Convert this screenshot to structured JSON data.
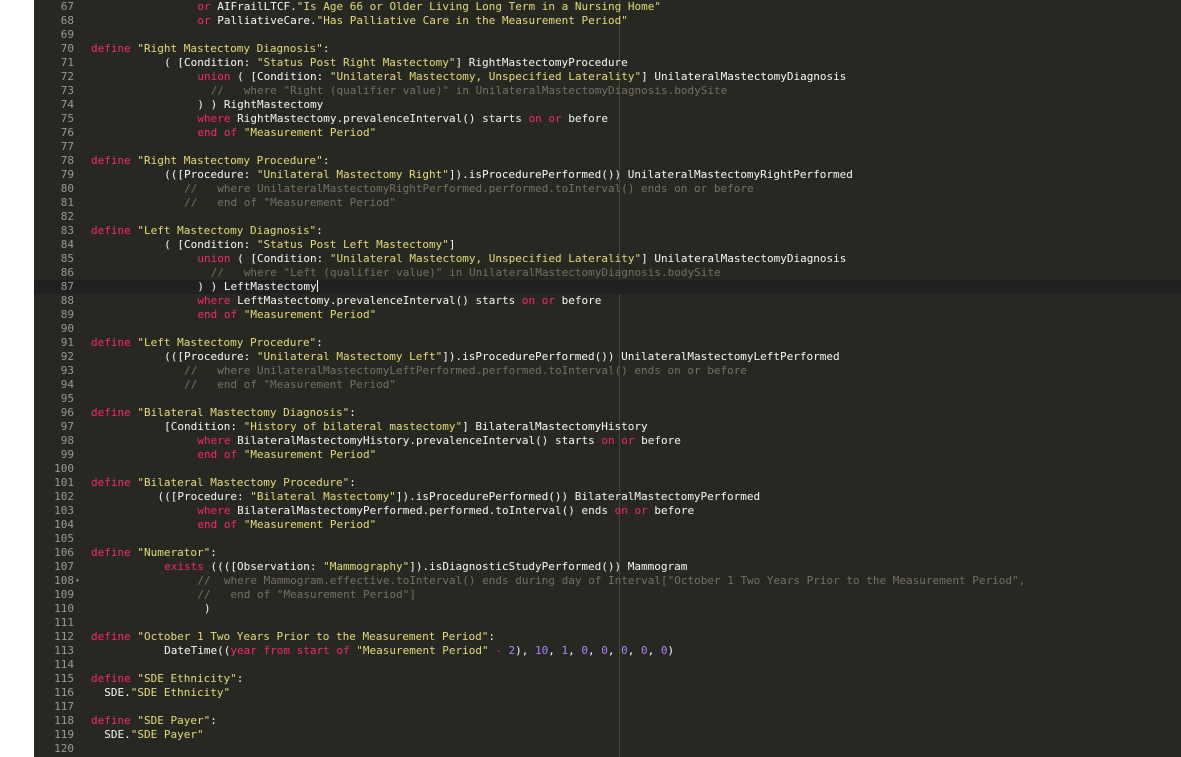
{
  "editor": {
    "active_line": 87,
    "cursor_line": 87,
    "lines": [
      {
        "n": "67",
        "i": 16,
        "t": [
          [
            "kw",
            "or"
          ],
          [
            "pl",
            " AIFrailLTCF."
          ],
          [
            "str",
            "\"Is Age 66 or Older Living Long Term in a Nursing Home\""
          ]
        ]
      },
      {
        "n": "68",
        "i": 16,
        "t": [
          [
            "kw",
            "or"
          ],
          [
            "pl",
            " PalliativeCare."
          ],
          [
            "str",
            "\"Has Palliative Care in the Measurement Period\""
          ]
        ]
      },
      {
        "n": "69",
        "i": 0,
        "t": []
      },
      {
        "n": "70",
        "i": 0,
        "t": [
          [
            "kw",
            "define"
          ],
          [
            "pl",
            " "
          ],
          [
            "str",
            "\"Right Mastectomy Diagnosis\""
          ],
          [
            "pl",
            ":"
          ]
        ]
      },
      {
        "n": "71",
        "i": 11,
        "t": [
          [
            "pl",
            "( [Condition: "
          ],
          [
            "str",
            "\"Status Post Right Mastectomy\""
          ],
          [
            "pl",
            "] RightMastectomyProcedure"
          ]
        ]
      },
      {
        "n": "72",
        "i": 16,
        "t": [
          [
            "kw",
            "union"
          ],
          [
            "pl",
            " ( [Condition: "
          ],
          [
            "str",
            "\"Unilateral Mastectomy, Unspecified Laterality\""
          ],
          [
            "pl",
            "] UnilateralMastectomyDiagnosis"
          ]
        ]
      },
      {
        "n": "73",
        "i": 18,
        "t": [
          [
            "cm",
            "//   where \"Right (qualifier value)\" in UnilateralMastectomyDiagnosis.bodySite"
          ]
        ]
      },
      {
        "n": "74",
        "i": 16,
        "t": [
          [
            "pl",
            ") ) RightMastectomy"
          ]
        ]
      },
      {
        "n": "75",
        "i": 16,
        "t": [
          [
            "kw",
            "where"
          ],
          [
            "pl",
            " RightMastectomy.prevalenceInterval() starts "
          ],
          [
            "kw",
            "on"
          ],
          [
            "pl",
            " "
          ],
          [
            "kw",
            "or"
          ],
          [
            "pl",
            " before"
          ]
        ]
      },
      {
        "n": "76",
        "i": 16,
        "t": [
          [
            "kw",
            "end of"
          ],
          [
            "pl",
            " "
          ],
          [
            "str",
            "\"Measurement Period\""
          ]
        ]
      },
      {
        "n": "77",
        "i": 0,
        "t": []
      },
      {
        "n": "78",
        "i": 0,
        "t": [
          [
            "kw",
            "define"
          ],
          [
            "pl",
            " "
          ],
          [
            "str",
            "\"Right Mastectomy Procedure\""
          ],
          [
            "pl",
            ":"
          ]
        ]
      },
      {
        "n": "79",
        "i": 11,
        "t": [
          [
            "pl",
            "(([Procedure: "
          ],
          [
            "str",
            "\"Unilateral Mastectomy Right\""
          ],
          [
            "pl",
            "]).isProcedurePerformed()) UnilateralMastectomyRightPerformed"
          ]
        ]
      },
      {
        "n": "80",
        "i": 14,
        "t": [
          [
            "cm",
            "//   where UnilateralMastectomyRightPerformed.performed.toInterval() ends on or before"
          ]
        ]
      },
      {
        "n": "81",
        "i": 14,
        "t": [
          [
            "cm",
            "//   end of \"Measurement Period\""
          ]
        ]
      },
      {
        "n": "82",
        "i": 0,
        "t": []
      },
      {
        "n": "83",
        "i": 0,
        "t": [
          [
            "kw",
            "define"
          ],
          [
            "pl",
            " "
          ],
          [
            "str",
            "\"Left Mastectomy Diagnosis\""
          ],
          [
            "pl",
            ":"
          ]
        ]
      },
      {
        "n": "84",
        "i": 11,
        "t": [
          [
            "pl",
            "( [Condition: "
          ],
          [
            "str",
            "\"Status Post Left Mastectomy\""
          ],
          [
            "pl",
            "]"
          ]
        ]
      },
      {
        "n": "85",
        "i": 16,
        "t": [
          [
            "kw",
            "union"
          ],
          [
            "pl",
            " ( [Condition: "
          ],
          [
            "str",
            "\"Unilateral Mastectomy, Unspecified Laterality\""
          ],
          [
            "pl",
            "] UnilateralMastectomyDiagnosis"
          ]
        ]
      },
      {
        "n": "86",
        "i": 18,
        "t": [
          [
            "cm",
            "//   where \"Left (qualifier value)\" in UnilateralMastectomyDiagnosis.bodySite"
          ]
        ]
      },
      {
        "n": "87",
        "i": 16,
        "t": [
          [
            "pl",
            ") ) LeftMastectomy"
          ]
        ]
      },
      {
        "n": "88",
        "i": 16,
        "t": [
          [
            "kw",
            "where"
          ],
          [
            "pl",
            " LeftMastectomy.prevalenceInterval() starts "
          ],
          [
            "kw",
            "on"
          ],
          [
            "pl",
            " "
          ],
          [
            "kw",
            "or"
          ],
          [
            "pl",
            " before"
          ]
        ]
      },
      {
        "n": "89",
        "i": 16,
        "t": [
          [
            "kw",
            "end of"
          ],
          [
            "pl",
            " "
          ],
          [
            "str",
            "\"Measurement Period\""
          ]
        ]
      },
      {
        "n": "90",
        "i": 0,
        "t": []
      },
      {
        "n": "91",
        "i": 0,
        "t": [
          [
            "kw",
            "define"
          ],
          [
            "pl",
            " "
          ],
          [
            "str",
            "\"Left Mastectomy Procedure\""
          ],
          [
            "pl",
            ":"
          ]
        ]
      },
      {
        "n": "92",
        "i": 11,
        "t": [
          [
            "pl",
            "(([Procedure: "
          ],
          [
            "str",
            "\"Unilateral Mastectomy Left\""
          ],
          [
            "pl",
            "]).isProcedurePerformed()) UnilateralMastectomyLeftPerformed"
          ]
        ]
      },
      {
        "n": "93",
        "i": 14,
        "t": [
          [
            "cm",
            "//   where UnilateralMastectomyLeftPerformed.performed.toInterval() ends on or before"
          ]
        ]
      },
      {
        "n": "94",
        "i": 14,
        "t": [
          [
            "cm",
            "//   end of \"Measurement Period\""
          ]
        ]
      },
      {
        "n": "95",
        "i": 0,
        "t": []
      },
      {
        "n": "96",
        "i": 0,
        "t": [
          [
            "kw",
            "define"
          ],
          [
            "pl",
            " "
          ],
          [
            "str",
            "\"Bilateral Mastectomy Diagnosis\""
          ],
          [
            "pl",
            ":"
          ]
        ]
      },
      {
        "n": "97",
        "i": 11,
        "t": [
          [
            "pl",
            "[Condition: "
          ],
          [
            "str",
            "\"History of bilateral mastectomy\""
          ],
          [
            "pl",
            "] BilateralMastectomyHistory"
          ]
        ]
      },
      {
        "n": "98",
        "i": 16,
        "t": [
          [
            "kw",
            "where"
          ],
          [
            "pl",
            " BilateralMastectomyHistory.prevalenceInterval() starts "
          ],
          [
            "kw",
            "on"
          ],
          [
            "pl",
            " "
          ],
          [
            "kw",
            "or"
          ],
          [
            "pl",
            " before"
          ]
        ]
      },
      {
        "n": "99",
        "i": 16,
        "t": [
          [
            "kw",
            "end of"
          ],
          [
            "pl",
            " "
          ],
          [
            "str",
            "\"Measurement Period\""
          ]
        ]
      },
      {
        "n": "100",
        "i": 0,
        "t": []
      },
      {
        "n": "101",
        "i": 0,
        "t": [
          [
            "kw",
            "define"
          ],
          [
            "pl",
            " "
          ],
          [
            "str",
            "\"Bilateral Mastectomy Procedure\""
          ],
          [
            "pl",
            ":"
          ]
        ]
      },
      {
        "n": "102",
        "i": 10,
        "t": [
          [
            "pl",
            "(([Procedure: "
          ],
          [
            "str",
            "\"Bilateral Mastectomy\""
          ],
          [
            "pl",
            "]).isProcedurePerformed()) BilateralMastectomyPerformed"
          ]
        ]
      },
      {
        "n": "103",
        "i": 16,
        "t": [
          [
            "kw",
            "where"
          ],
          [
            "pl",
            " BilateralMastectomyPerformed.performed.toInterval() ends "
          ],
          [
            "kw",
            "on"
          ],
          [
            "pl",
            " "
          ],
          [
            "kw",
            "or"
          ],
          [
            "pl",
            " before"
          ]
        ]
      },
      {
        "n": "104",
        "i": 16,
        "t": [
          [
            "kw",
            "end of"
          ],
          [
            "pl",
            " "
          ],
          [
            "str",
            "\"Measurement Period\""
          ]
        ]
      },
      {
        "n": "105",
        "i": 0,
        "t": []
      },
      {
        "n": "106",
        "i": 0,
        "t": [
          [
            "kw",
            "define"
          ],
          [
            "pl",
            " "
          ],
          [
            "str",
            "\"Numerator\""
          ],
          [
            "pl",
            ":"
          ]
        ]
      },
      {
        "n": "107",
        "i": 11,
        "t": [
          [
            "kw",
            "exists"
          ],
          [
            "pl",
            " (((["
          ],
          [
            "pl",
            "Observation: "
          ],
          [
            "str",
            "\"Mammography\""
          ],
          [
            "pl",
            "]).isDiagnosticStudyPerformed()) Mammogram"
          ]
        ]
      },
      {
        "n": "108",
        "i": 16,
        "fold": true,
        "t": [
          [
            "cm",
            "//  where Mammogram.effective.toInterval() ends during day of Interval[\"October 1 Two Years Prior to the Measurement Period\","
          ]
        ]
      },
      {
        "n": "109",
        "i": 16,
        "t": [
          [
            "cm",
            "//   end of \"Measurement Period\"]"
          ]
        ]
      },
      {
        "n": "110",
        "i": 17,
        "t": [
          [
            "pl",
            ")"
          ]
        ]
      },
      {
        "n": "111",
        "i": 0,
        "t": []
      },
      {
        "n": "112",
        "i": 0,
        "t": [
          [
            "kw",
            "define"
          ],
          [
            "pl",
            " "
          ],
          [
            "str",
            "\"October 1 Two Years Prior to the Measurement Period\""
          ],
          [
            "pl",
            ":"
          ]
        ]
      },
      {
        "n": "113",
        "i": 11,
        "t": [
          [
            "pl",
            "DateTime(("
          ],
          [
            "kw",
            "year from start of"
          ],
          [
            "pl",
            " "
          ],
          [
            "str",
            "\"Measurement Period\""
          ],
          [
            "pl",
            " "
          ],
          [
            "kw",
            "-"
          ],
          [
            "pl",
            " "
          ],
          [
            "num",
            "2"
          ],
          [
            "pl",
            "), "
          ],
          [
            "num",
            "10"
          ],
          [
            "pl",
            ", "
          ],
          [
            "num",
            "1"
          ],
          [
            "pl",
            ", "
          ],
          [
            "num",
            "0"
          ],
          [
            "pl",
            ", "
          ],
          [
            "num",
            "0"
          ],
          [
            "pl",
            ", "
          ],
          [
            "num",
            "0"
          ],
          [
            "pl",
            ", "
          ],
          [
            "num",
            "0"
          ],
          [
            "pl",
            ", "
          ],
          [
            "num",
            "0"
          ],
          [
            "pl",
            ")"
          ]
        ]
      },
      {
        "n": "114",
        "i": 0,
        "t": []
      },
      {
        "n": "115",
        "i": 0,
        "t": [
          [
            "kw",
            "define"
          ],
          [
            "pl",
            " "
          ],
          [
            "str",
            "\"SDE Ethnicity\""
          ],
          [
            "pl",
            ":"
          ]
        ]
      },
      {
        "n": "116",
        "i": 2,
        "t": [
          [
            "pl",
            "SDE."
          ],
          [
            "str",
            "\"SDE Ethnicity\""
          ]
        ]
      },
      {
        "n": "117",
        "i": 0,
        "t": []
      },
      {
        "n": "118",
        "i": 0,
        "t": [
          [
            "kw",
            "define"
          ],
          [
            "pl",
            " "
          ],
          [
            "str",
            "\"SDE Payer\""
          ],
          [
            "pl",
            ":"
          ]
        ]
      },
      {
        "n": "119",
        "i": 2,
        "t": [
          [
            "pl",
            "SDE."
          ],
          [
            "str",
            "\"SDE Payer\""
          ]
        ]
      },
      {
        "n": "120",
        "i": 0,
        "t": []
      }
    ]
  },
  "colors": {
    "background": "#272822",
    "keyword": "#f92672",
    "string": "#e6db74",
    "number": "#ae81ff",
    "comment": "#75715e",
    "plain": "#f8f8f2",
    "line_number": "#9a9a94"
  }
}
